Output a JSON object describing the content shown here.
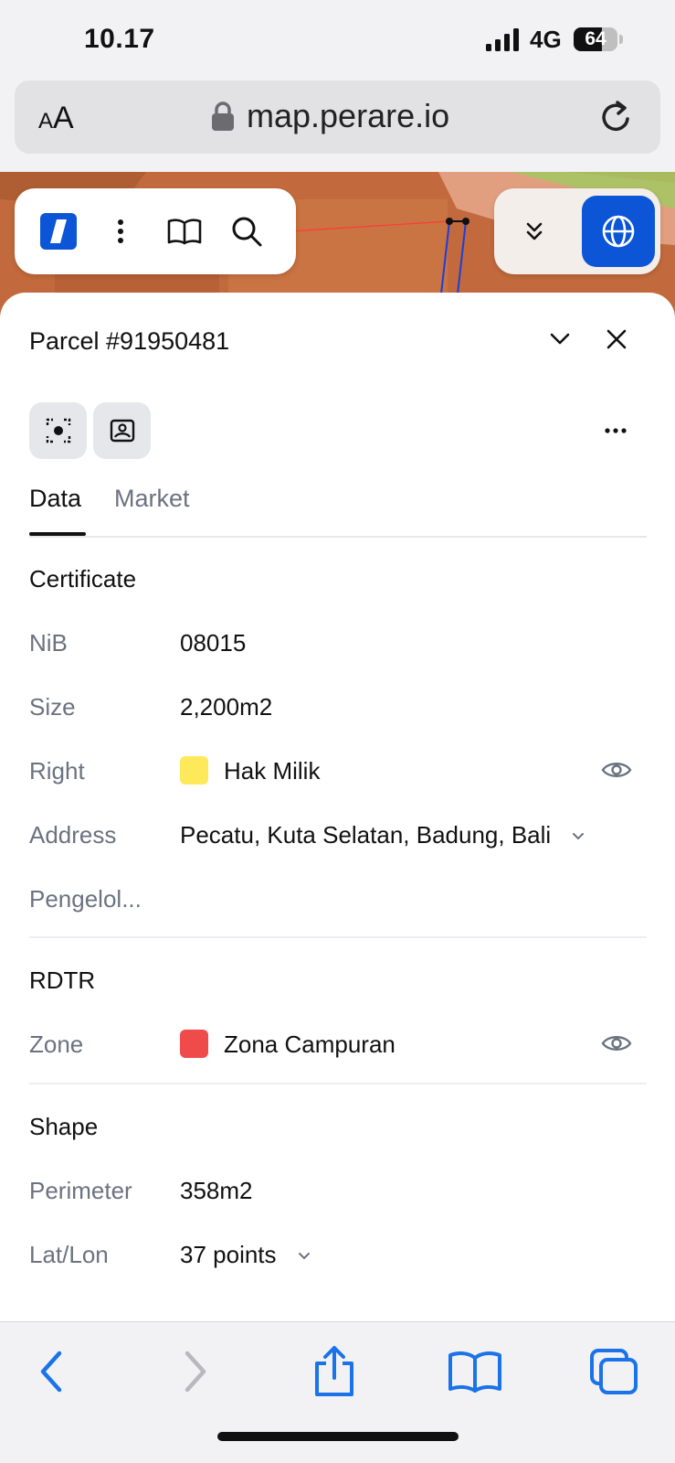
{
  "status_bar": {
    "time": "10.17",
    "network": "4G",
    "battery": "64",
    "battery_level": 0.64
  },
  "browser": {
    "text_size_label_small": "A",
    "text_size_label_large": "A",
    "url": "map.perare.io"
  },
  "panel": {
    "title": "Parcel #91950481",
    "tabs": [
      {
        "label": "Data",
        "active": true
      },
      {
        "label": "Market",
        "active": false
      }
    ],
    "certificate": {
      "heading": "Certificate",
      "nib_label": "NiB",
      "nib_value": "08015",
      "size_label": "Size",
      "size_value": "2,200m2",
      "right_label": "Right",
      "right_value": "Hak Milik",
      "right_color": "#fde95a",
      "address_label": "Address",
      "address_value": "Pecatu, Kuta Selatan, Badung, Bali",
      "manager_label": "Pengelol..."
    },
    "rdtr": {
      "heading": "RDTR",
      "zone_label": "Zone",
      "zone_value": "Zona Campuran",
      "zone_color": "#f04b4b"
    },
    "shape": {
      "heading": "Shape",
      "perimeter_label": "Perimeter",
      "perimeter_value": "358m2",
      "latlon_label": "Lat/Lon",
      "latlon_value": "37 points"
    }
  },
  "colors": {
    "accent": "#0b55d6",
    "safari_blue": "#1a73e8"
  }
}
